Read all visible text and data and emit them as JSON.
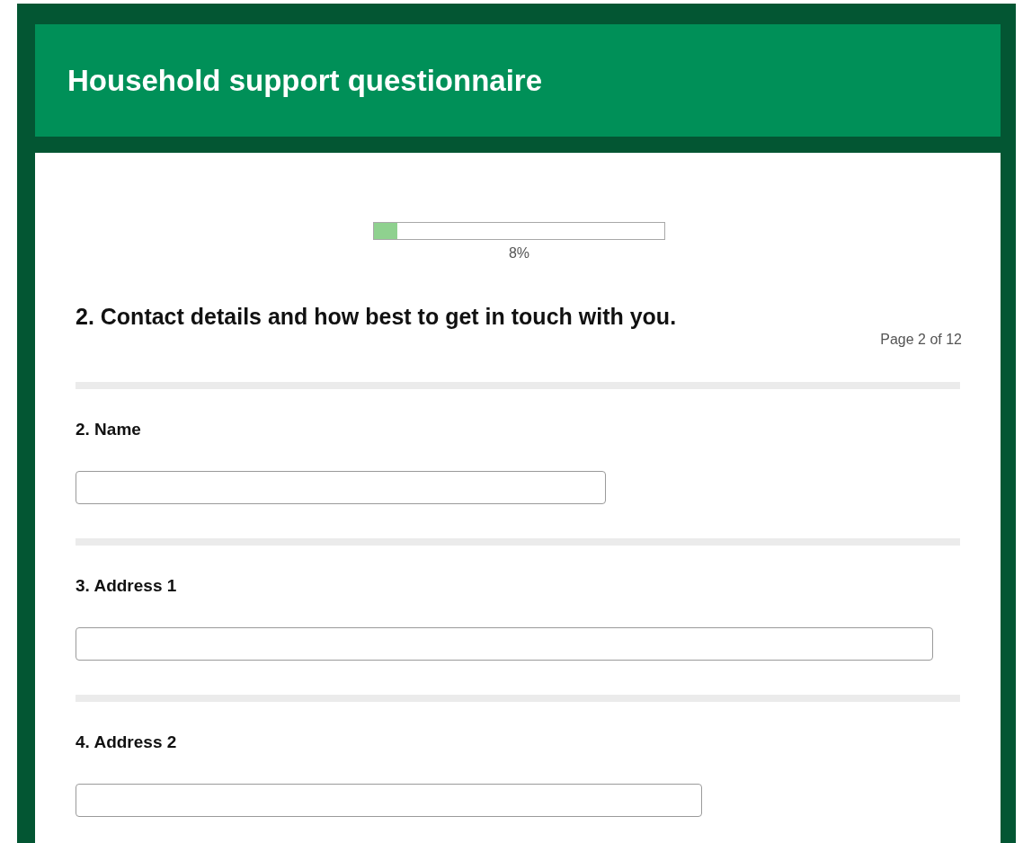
{
  "header": {
    "title": "Household support questionnaire"
  },
  "progress": {
    "level": 0.08,
    "reading": "8%"
  },
  "section": {
    "title": "2. Contact details and how best to get in touch with you.",
    "page": "Page 2 of 12"
  },
  "questions": [
    {
      "label": "2. Name",
      "kind": "short"
    },
    {
      "label": "3. Address 1",
      "kind": "long"
    },
    {
      "label": "4. Address 2",
      "kind": "medium"
    }
  ]
}
